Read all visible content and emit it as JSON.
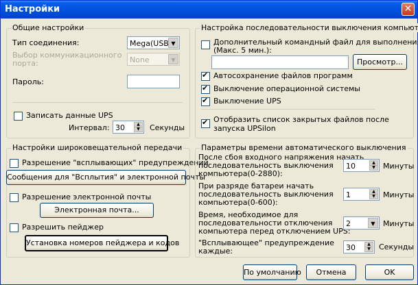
{
  "window": {
    "title": "Настройки",
    "close_glyph": "✕"
  },
  "general": {
    "title": "Общие настройки",
    "conn_type_label": "Тип соединения:",
    "conn_type_value": "Mega(USB)",
    "comm_port_label1": "Выбор коммуникационного",
    "comm_port_label2": "порта:",
    "comm_port_value": "None",
    "password_label": "Пароль:",
    "password_value": "",
    "log_label": "Записать данные UPS",
    "interval_label": "Интервал:",
    "interval_value": "30",
    "seconds_label": "Секунды"
  },
  "broadcast": {
    "title": "Настройки широковещательной передачи",
    "popup_label": "Разрешение \"всплывающих\" предупреждений",
    "popup_button": "Сообщения для \"Всплытия\" и электронной почты",
    "email_label": "Разрешение электронной почты",
    "email_button": "Электронная почта...",
    "pager_label": "Разрешить пейджер",
    "pager_button": "Установка номеров пейджера и кодов"
  },
  "shutdown_seq": {
    "title": "Настройка последовательности выключения компьютера",
    "cmd_label1": "Дополнительный командный файл для выполнения",
    "cmd_label2": "(Макс. 5 мин.):",
    "cmd_value": "",
    "browse_button": "Просмотр...",
    "autosave_label": "Автосохранение файлов программ",
    "os_shutdown_label": "Выключение операционной системы",
    "ups_shutdown_label": "Выключение UPS",
    "show_list_label1": "Отобразить список закрытых файлов после",
    "show_list_label2": "запуска UPSilon"
  },
  "timing": {
    "title": "Параметры времени автоматического выключения",
    "power_fail_l1": "После сбоя входного напряжения начать",
    "power_fail_l2": "последовательность выключения",
    "power_fail_l3": "компьютера(0-2880):",
    "power_fail_value": "10",
    "battery_l1": "При разряде батареи начать",
    "battery_l2": "последовательность выключения",
    "battery_l3": "компьютера(0-600):",
    "battery_value": "1",
    "required_l1": "Время, необходимое для",
    "required_l2": "последовательности отключения",
    "required_l3": "компьютера перед отключением UPS:",
    "required_value": "2",
    "popup_every_l1": "\"Всплывающее\" предупреждение",
    "popup_every_l2": "каждые:",
    "popup_every_value": "30",
    "minutes_label": "Минуты",
    "seconds_label": "Секунды"
  },
  "footer": {
    "default_button": "По умолчанию",
    "cancel_button": "Отмена",
    "ok_button": "OK"
  }
}
